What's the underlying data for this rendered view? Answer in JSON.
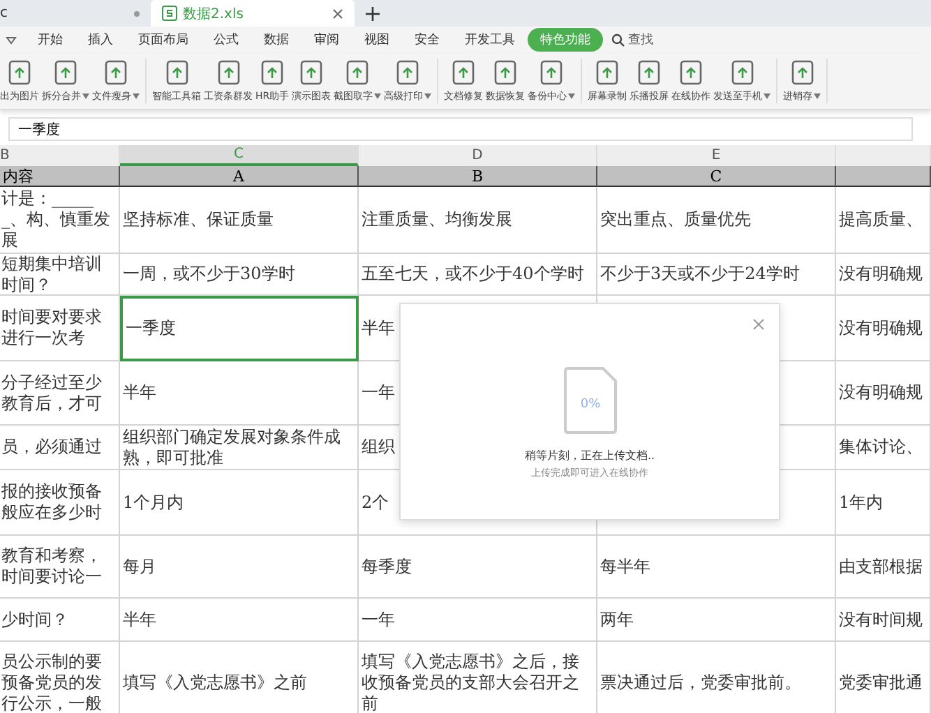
{
  "doc_tabs": [
    {
      "label": "c",
      "selected": false
    },
    {
      "label": "数据2.xls",
      "selected": true
    }
  ],
  "menu": [
    {
      "label": "开始",
      "selected": false
    },
    {
      "label": "插入",
      "selected": false
    },
    {
      "label": "页面布局",
      "selected": false
    },
    {
      "label": "公式",
      "selected": false
    },
    {
      "label": "数据",
      "selected": false
    },
    {
      "label": "审阅",
      "selected": false
    },
    {
      "label": "视图",
      "selected": false
    },
    {
      "label": "安全",
      "selected": false
    },
    {
      "label": "开发工具",
      "selected": false
    },
    {
      "label": "特色功能",
      "selected": true
    }
  ],
  "search": {
    "label": "查找"
  },
  "ribbon_groups": [
    [
      {
        "label": "出为图片",
        "dropdown": false
      },
      {
        "label": "拆分合并",
        "dropdown": true
      },
      {
        "label": "文件瘦身",
        "dropdown": true
      }
    ],
    [
      {
        "label": "智能工具箱",
        "dropdown": false
      },
      {
        "label": "工资条群发",
        "dropdown": false
      },
      {
        "label": "HR助手",
        "dropdown": false
      },
      {
        "label": "演示图表",
        "dropdown": false
      },
      {
        "label": "截图取字",
        "dropdown": true
      },
      {
        "label": "高级打印",
        "dropdown": true
      }
    ],
    [
      {
        "label": "文档修复",
        "dropdown": false
      },
      {
        "label": "数据恢复",
        "dropdown": false
      },
      {
        "label": "备份中心",
        "dropdown": true
      }
    ],
    [
      {
        "label": "屏幕录制",
        "dropdown": false
      },
      {
        "label": "乐播投屏",
        "dropdown": false
      },
      {
        "label": "在线协作",
        "dropdown": false
      },
      {
        "label": "发送至手机",
        "dropdown": true
      }
    ],
    [
      {
        "label": "进销存",
        "dropdown": true
      }
    ]
  ],
  "formula_bar": {
    "value": "一季度"
  },
  "column_headers": [
    {
      "label": "B",
      "selected": false
    },
    {
      "label": "C",
      "selected": true
    },
    {
      "label": "D",
      "selected": false
    },
    {
      "label": "E",
      "selected": false
    },
    {
      "selected": false
    }
  ],
  "header_row": [
    "内容",
    "A",
    "B",
    "C"
  ],
  "rows": [
    [
      {
        "text": "计是：______、构、慎重发展",
        "selected": false
      },
      {
        "text": "坚持标准、保证质量",
        "selected": false
      },
      {
        "text": "注重质量、均衡发展",
        "selected": false
      },
      {
        "text": "突出重点、质量优先",
        "selected": false
      },
      {
        "text": "提高质量、",
        "selected": false
      }
    ],
    [
      {
        "text": "短期集中培训时间？",
        "selected": false
      },
      {
        "text": "一周，或不少于30学时",
        "selected": false
      },
      {
        "text": "五至七天，或不少于40个学时",
        "selected": false
      },
      {
        "text": "不少于3天或不少于24学时",
        "selected": false
      },
      {
        "text": "没有明确规",
        "selected": false
      }
    ],
    [
      {
        "text": "时间要对要求进行一次考",
        "selected": false
      },
      {
        "text": "一季度",
        "selected": true
      },
      {
        "text": "半年",
        "selected": false
      },
      {
        "selected": false
      },
      {
        "text": "没有明确规",
        "selected": false
      }
    ],
    [
      {
        "text": "分子经过至少教育后，才可",
        "selected": false
      },
      {
        "text": "半年",
        "selected": false
      },
      {
        "text": "一年",
        "selected": false
      },
      {
        "selected": false
      },
      {
        "text": "没有明确规",
        "selected": false
      }
    ],
    [
      {
        "text": "员，必须通过",
        "selected": false
      },
      {
        "text": "组织部门确定发展对象条件成熟，即可批准",
        "selected": false
      },
      {
        "text": "组织",
        "selected": false
      },
      {
        "selected": false
      },
      {
        "text": "集体讨论、",
        "selected": false
      }
    ],
    [
      {
        "text": "报的接收预备般应在多少时",
        "selected": false
      },
      {
        "text": "1个月内",
        "selected": false
      },
      {
        "text": "2个",
        "selected": false
      },
      {
        "selected": false
      },
      {
        "text": "1年内",
        "selected": false
      }
    ],
    [
      {
        "text": "教育和考察，时间要讨论一",
        "selected": false
      },
      {
        "text": "每月",
        "selected": false
      },
      {
        "text": "每季度",
        "selected": false
      },
      {
        "text": "每半年",
        "selected": false
      },
      {
        "text": "由支部根据",
        "selected": false
      }
    ],
    [
      {
        "text": "少时间？",
        "selected": false
      },
      {
        "text": "半年",
        "selected": false
      },
      {
        "text": "一年",
        "selected": false
      },
      {
        "text": "两年",
        "selected": false
      },
      {
        "text": "没有时间规",
        "selected": false
      }
    ],
    [
      {
        "text": "员公示制的要预备党员的发行公示，一般",
        "selected": false
      },
      {
        "text": "填写《入党志愿书》之前",
        "selected": false
      },
      {
        "text": "填写《入党志愿书》之后，接收预备党员的支部大会召开之前",
        "selected": false
      },
      {
        "text": "票决通过后，党委审批前。",
        "selected": false
      },
      {
        "text": "党委审批通",
        "selected": false
      }
    ]
  ],
  "upload_dialog": {
    "progress": "0%",
    "message": "稍等片刻，正在上传文档..",
    "hint": "上传完成即可进入在线协作"
  }
}
